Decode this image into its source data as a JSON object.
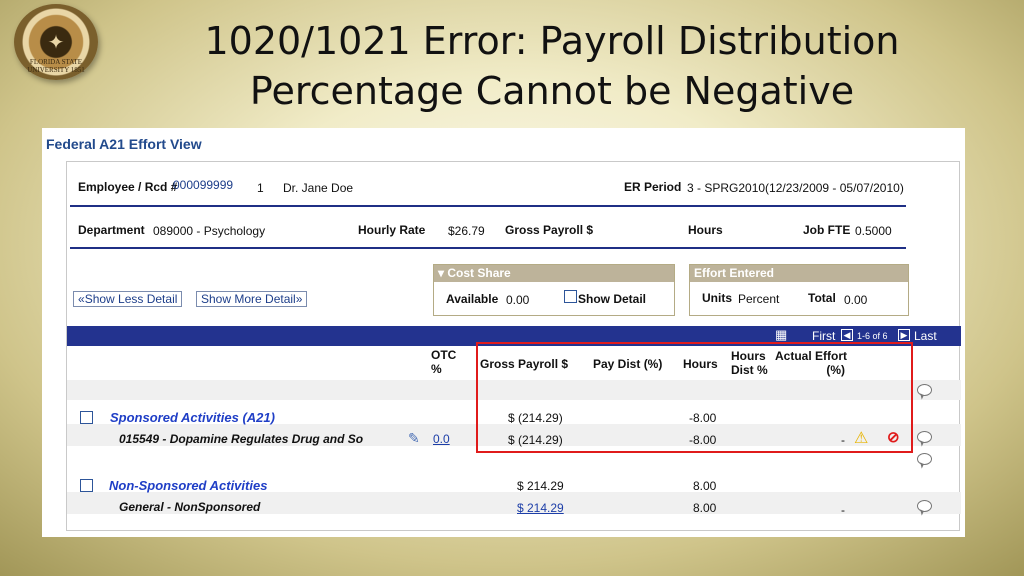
{
  "slide": {
    "title_line1": "1020/1021 Error: Payroll Distribution",
    "title_line2": "Percentage Cannot be Negative",
    "seal_text": "FLORIDA STATE UNIVERSITY 1851"
  },
  "page": {
    "title": "Federal A21 Effort View"
  },
  "employee": {
    "label": "Employee / Rcd #",
    "id": "000099999",
    "rcd": "1",
    "name": "Dr. Jane Doe",
    "er_period_label": "ER Period",
    "er_period_value": "3 - SPRG2010(12/23/2009 - 05/07/2010)"
  },
  "department": {
    "label": "Department",
    "value": "089000 - Psychology",
    "hourly_rate_label": "Hourly Rate",
    "hourly_rate_value": "$26.79",
    "gross_payroll_label": "Gross Payroll $",
    "hours_label": "Hours",
    "job_fte_label": "Job FTE",
    "job_fte_value": "0.5000"
  },
  "buttons": {
    "show_less": "Show Less Detail",
    "show_more": "Show More Detail"
  },
  "cost_share": {
    "header": "Cost Share",
    "available_label": "Available",
    "available_value": "0.00",
    "show_detail": "Show Detail"
  },
  "effort_entered": {
    "header": "Effort Entered",
    "units_label": "Units",
    "units_value": "Percent",
    "total_label": "Total",
    "total_value": "0.00"
  },
  "grid_nav": {
    "first": "First",
    "range": "1-6 of 6",
    "last": "Last"
  },
  "columns": {
    "otc": [
      "OTC",
      "%"
    ],
    "gross_payroll": "Gross Payroll $",
    "pay_dist": "Pay Dist (%)",
    "hours": "Hours",
    "hours_dist": [
      "Hours",
      "Dist %"
    ],
    "actual_effort": [
      "Actual Effort",
      "(%)"
    ]
  },
  "rows": [
    {
      "label": "Sponsored Activities (A21)",
      "gross": "$ (214.29)",
      "hours": "-8.00"
    },
    {
      "label": "015549 - Dopamine Regulates Drug and So",
      "otc": "0.0",
      "gross": "$ (214.29)",
      "hours": "-8.00",
      "effort": "-"
    },
    {
      "label": "Non-Sponsored Activities",
      "gross": "$ 214.29",
      "hours": "8.00"
    },
    {
      "label": "General - NonSponsored",
      "gross": "$ 214.29",
      "hours": "8.00",
      "effort": "-"
    }
  ],
  "colors": {
    "accent_navy": "#23338f",
    "link_blue": "#1f3ec6",
    "highlight_red": "#e01b1b",
    "box_header": "#bdb39a"
  }
}
